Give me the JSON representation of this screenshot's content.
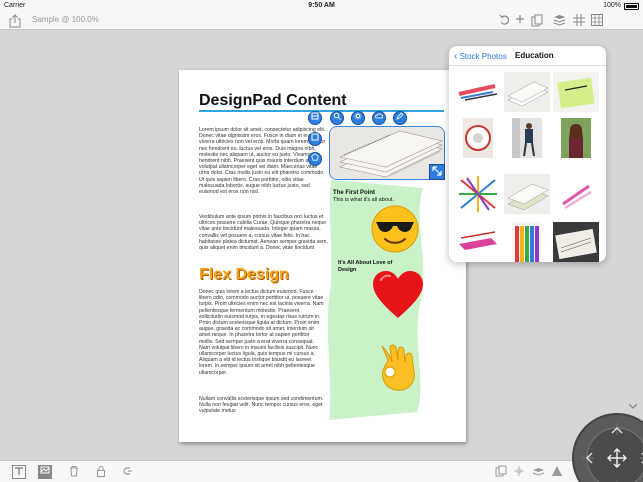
{
  "status_bar": {
    "carrier": "Carrier",
    "time": "9:50 AM",
    "battery": "100%"
  },
  "toolbar": {
    "doc_title": "Sample @ 100.0%",
    "left_icons": [
      "share-icon"
    ],
    "right_icons": [
      "undo-icon",
      "add-icon",
      "page-icon",
      "stack-icon",
      "grid-icon",
      "layout-icon"
    ]
  },
  "page": {
    "title": "DesignPad Content",
    "para1": "Lorem ipsum dolor sit amet, consectetur adipiscing elit. Donec vitae dignissim eros. Fusce in diam et erat viverra ultricies non vel eros. Morbi quam lorem, auctor nec hendrerit eu, luctus vel eros. Duis magna nibh, molestie nec aliquam ut, auctor eu justo. Vivamus et hendrerit nibh. Praesent quis mauris interdum ante volutpat ullamcorper eget vel diam. Maecenas vitae urna dolor. Cras mollis justo eu elit pharetra commodo. Ut quis sapien libero. Cras porttitor, odio vitae malesuada lobortis, augue nibh luctus justo, sed euismod est eros non nisl.",
    "para2": "Vestibulum ante ipsum primis in faucibus orci luctus et ultrices posuere cubilia Curae; Quisque pharetra neque vitae ante tincidunt malesuada. Integer quam massa, convallis vel posuere a, cursus vitae felis. In hac habitasse platea dictumst. Aenean semper gravida sem, quis aliquet enim tincidunt a. Donec vitae tincidunt",
    "heading2": "Flex Design",
    "para3": "Donec quis lorem a lectus dictum euismod. Fusce libero odio, commodo auctor porttitor ut, posuere vitae turpis. Proin ultricies enim nec est lacinia viverra. Nam pellentesque fermentum molestie. Praesent sollicitudin euismod turpis, in egestas risus rutrum in. Proin dictum scelerisque ligula at dictum. Proin enim augue, gravida ac commodo sit amet, interdum sit amet neque. In pharetra tortor at sapien porttitor mollis. Sed semper justo a erat viverra consequat. Nam volutpat libero in mauris facilisis suscipit. Nunc ullamcorper luctus ligula, quis tempus mi cursus a. Aliquam a elit id lectus tristique blandit eu laoreet lorem. In semper ipsum sit amet nibh pellentesque ullamcorper.",
    "para4": "Nullam convallis scelerisque ipsum sed condimentum. Nulla non feugiat velit. Nunc tempor cursus eros, eget vulputate metus",
    "callout1_title": "The First Point",
    "callout1_body": "This is what it's all about.",
    "callout2": "It's All About Love of Design"
  },
  "selection_handles": [
    "crop-icon",
    "zoom-icon",
    "settings-icon",
    "cloud-icon",
    "pencil-icon",
    "square-shape-icon",
    "pentagon-shape-icon",
    "resize-icon"
  ],
  "emojis": [
    "sunglasses-emoji",
    "heart-emoji",
    "ok-hand-emoji"
  ],
  "popover": {
    "back_label": "Stock Photos",
    "title": "Education",
    "thumbnails": [
      "crayons",
      "notebooks",
      "notebook-green",
      "pencil-sharpener",
      "student-walking",
      "student-girl",
      "colored-pencils",
      "notebook-stack",
      "pink-pencils",
      "pink-eraser",
      "colored-pencils-box",
      "notebook-pen"
    ]
  },
  "bottom_toolbar": {
    "left_icons": [
      "text-icon",
      "image-icon",
      "trash-icon",
      "lock-icon",
      "link-icon"
    ],
    "right_icons": [
      "duplicate-icon",
      "align-icon",
      "layer-icon",
      "flip-icon"
    ]
  },
  "colors": {
    "accent": "#2d7be0",
    "rule": "#2da6dd",
    "flex_heading": "#f4a21b",
    "green_band": "#c9f2c9"
  }
}
